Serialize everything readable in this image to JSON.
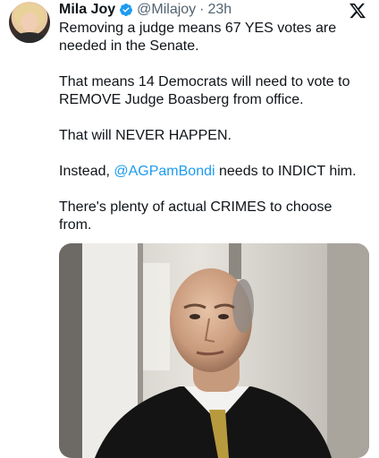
{
  "tweet": {
    "author_name": "Mila Joy",
    "handle": "@Milajoy",
    "separator": "·",
    "time": "23h",
    "verified_color": "#1d9bf0",
    "mention_color": "#1d9bf0",
    "paragraphs": [
      "Removing  a judge means 67 YES votes are needed in the Senate.",
      "That means 14 Democrats will need to vote to REMOVE Judge Boasberg from office.",
      "That will NEVER HAPPEN."
    ],
    "para4_before": "Instead, ",
    "para4_mention": "@AGPamBondi",
    "para4_after": " needs to INDICT him.",
    "para5": "There's plenty of actual CRIMES to choose from."
  },
  "icons": {
    "verified": "verified-badge-icon",
    "logo": "x-logo-icon"
  }
}
